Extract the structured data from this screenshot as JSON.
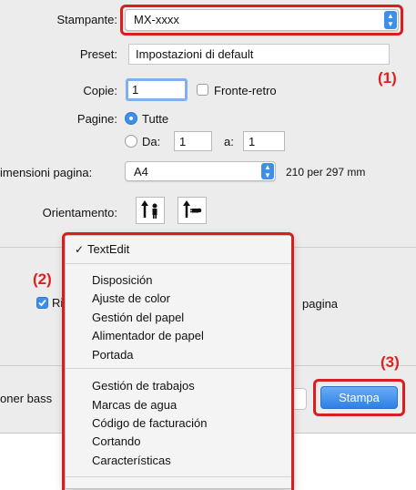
{
  "dialog": {
    "printer": {
      "label": "Stampante:",
      "value": "MX-xxxx"
    },
    "preset": {
      "label": "Preset:",
      "value": "Impostazioni di default"
    },
    "copies": {
      "label": "Copie:",
      "value": "1",
      "duplex_label": "Fronte-retro"
    },
    "pages": {
      "label": "Pagine:",
      "all_label": "Tutte",
      "from_label": "Da:",
      "from_value": "1",
      "to_label": "a:",
      "to_value": "1"
    },
    "paper_size": {
      "label": "imensioni pagina:",
      "value": "A4",
      "dimensions": "210 per 297 mm"
    },
    "orientation": {
      "label": "Orientamento:"
    },
    "partial_checkbox_label": "Ri",
    "partial_page_label": "pagina",
    "partial_low_toner_label": "oner bass",
    "print_button_label": "Stampa"
  },
  "menu": {
    "checked_item": "TextEdit",
    "group1": [
      "Disposición",
      "Ajuste de color",
      "Gestión del papel",
      "Alimentador de papel",
      "Portada"
    ],
    "group2": [
      "Gestión de trabajos",
      "Marcas de agua",
      "Código de facturación",
      "Cortando",
      "Características"
    ]
  },
  "callouts": {
    "one": "(1)",
    "two": "(2)",
    "three": "(3)"
  },
  "colors": {
    "accent": "#3d8fe8",
    "callout": "#d81e1e",
    "window_bg": "#ececec"
  }
}
